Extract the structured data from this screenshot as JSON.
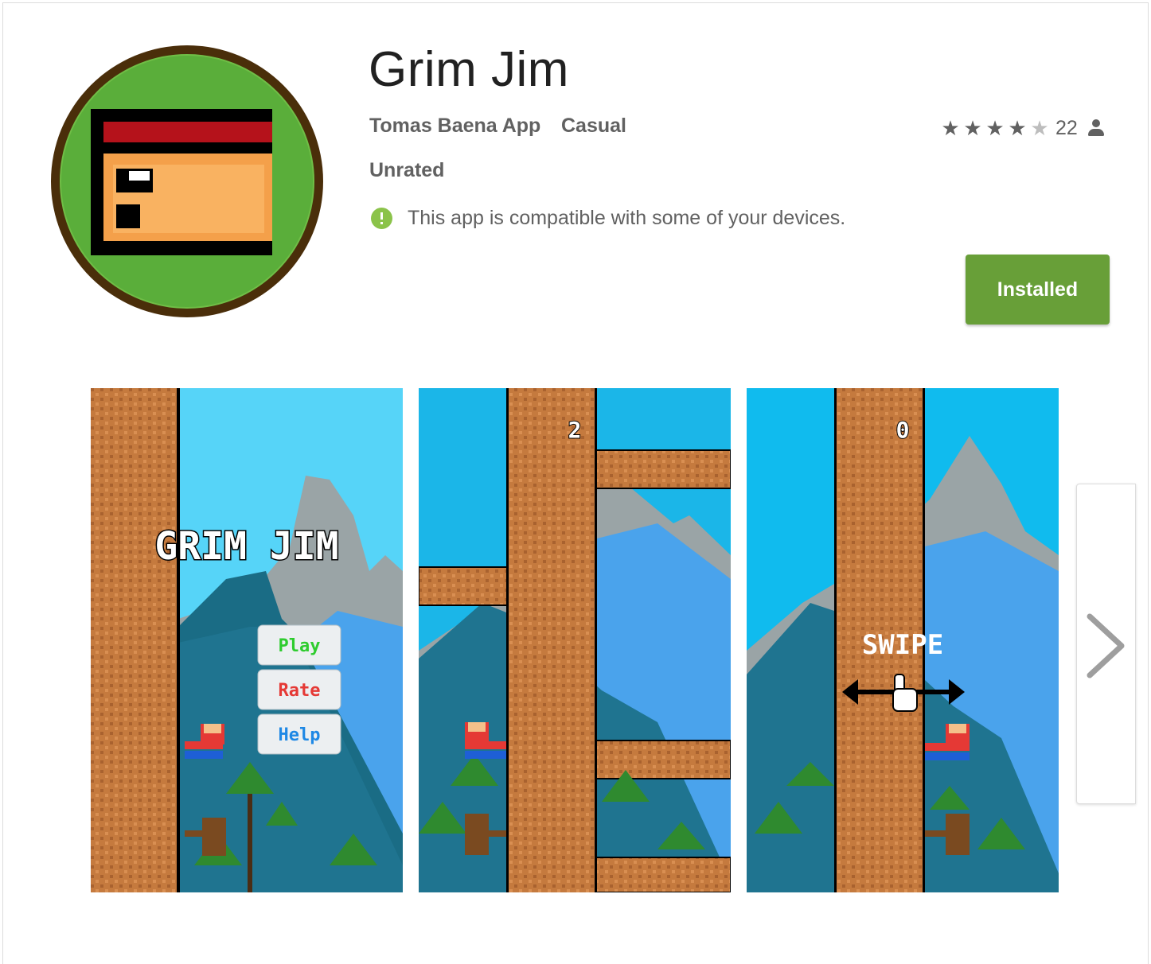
{
  "app": {
    "title": "Grim Jim",
    "developer": "Tomas Baena App",
    "category": "Casual",
    "content_rating": "Unrated",
    "compatibility": "This app is compatible with some of your devices.",
    "rating": {
      "stars": 4.5,
      "max": 5,
      "count": "22"
    },
    "install_label": "Installed"
  },
  "icons": {
    "compat": "info-circle-icon",
    "person": "person-icon",
    "next": "chevron-right-icon",
    "star": "star-icon"
  },
  "screenshots": [
    {
      "id": "menu",
      "game_title": "GRIM JIM",
      "buttons": [
        "Play",
        "Rate",
        "Help"
      ]
    },
    {
      "id": "gameplay",
      "score": "2"
    },
    {
      "id": "tutorial",
      "score": "0",
      "hint": "SWIPE"
    }
  ],
  "colors": {
    "install": "#689f38",
    "text_secondary": "#616161",
    "compat_icon": "#8bc34a"
  }
}
